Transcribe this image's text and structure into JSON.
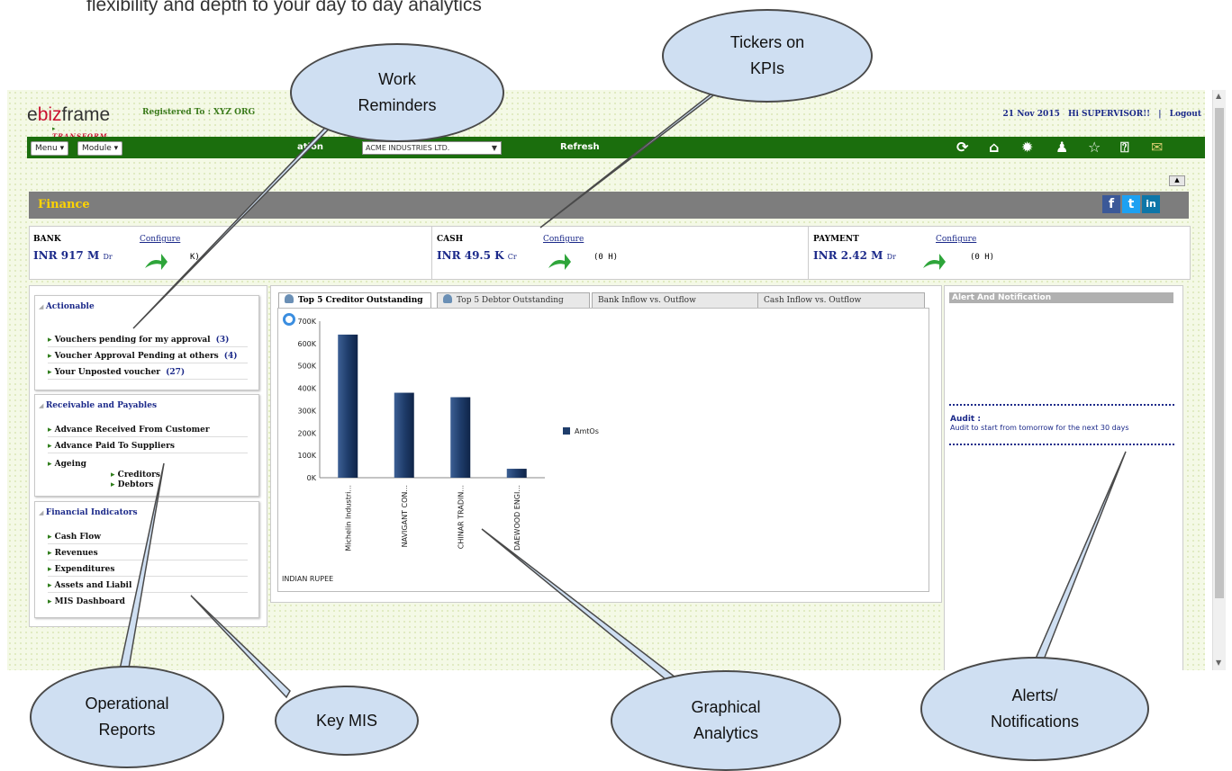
{
  "caption": "flexibility and depth to your day to day analytics",
  "header": {
    "logo_e": "e",
    "logo_biz": "biz",
    "logo_frame": "frame",
    "logo_sub": "TRANSFORM",
    "registered": "Registered To :  XYZ ORG",
    "date": "21 Nov 2015",
    "greeting": "Hi SUPERVISOR!!",
    "separator": "|",
    "logout": "Logout"
  },
  "toolbar": {
    "menu": "Menu ▾",
    "module": "Module ▾",
    "org_label": "ation",
    "org_value": "ACME INDUSTRIES LTD.",
    "refresh": "Refresh"
  },
  "finance": {
    "title": "Finance",
    "social": [
      "f",
      "t",
      "in"
    ]
  },
  "kpis": [
    {
      "name": "BANK",
      "configure": "Configure",
      "value": "INR  917  M",
      "unit": "Dr",
      "change": "K)"
    },
    {
      "name": "CASH",
      "configure": "Configure",
      "value": "INR  49.5  K",
      "unit": "Cr",
      "change": "(0 H)"
    },
    {
      "name": "PAYMENT",
      "configure": "Configure",
      "value": "INR  2.42  M",
      "unit": "Dr",
      "change": "(0 H)"
    }
  ],
  "actionable": {
    "title": "Actionable",
    "items": [
      {
        "label": "Vouchers pending for my approval",
        "count": "(3)"
      },
      {
        "label": "Voucher Approval Pending at others",
        "count": "(4)"
      },
      {
        "label": "Your Unposted voucher",
        "count": "(27)"
      }
    ]
  },
  "receivables": {
    "title": "Receivable and Payables",
    "items": [
      "Advance Received From Customer",
      "Advance Paid To Suppliers",
      "Ageing"
    ],
    "subitems": [
      "Creditors",
      "Debtors"
    ]
  },
  "indicators": {
    "title": "Financial Indicators",
    "items": [
      "Cash Flow",
      "Revenues",
      "Expenditures",
      "Assets and Liabil",
      "MIS Dashboard"
    ]
  },
  "tabs": [
    "Top 5 Creditor Outstanding",
    "Top 5 Debtor Outstanding",
    "Bank Inflow vs. Outflow",
    "Cash Inflow vs. Outflow"
  ],
  "chart_data": {
    "type": "bar",
    "categories": [
      "Michelin Industri...",
      "NAVIGANT CON...",
      "CHINAR TRADIN...",
      "DAEWOOD ENGI..."
    ],
    "values": [
      640000,
      380000,
      360000,
      40000
    ],
    "yticks": [
      "0K",
      "100K",
      "200K",
      "300K",
      "400K",
      "500K",
      "600K",
      "700K"
    ],
    "ylim": [
      0,
      700000
    ],
    "series": [
      {
        "name": "AmtOs",
        "color": "#1f3d6b"
      }
    ],
    "footer": "INDIAN RUPEE",
    "legend_position": "right"
  },
  "alerts": {
    "title": "Alert And Notification",
    "audit_title": "Audit :",
    "audit_text": "Audit to start from tomorrow for the next 30 days"
  },
  "callouts": {
    "work_reminders": [
      "Work",
      "Reminders"
    ],
    "tickers": [
      "Tickers on",
      "KPIs"
    ],
    "operational": [
      "Operational",
      "Reports"
    ],
    "key_mis": "Key MIS",
    "graphical": [
      "Graphical",
      "Analytics"
    ],
    "alerts": [
      "Alerts/",
      "Notifications"
    ]
  },
  "colors": {
    "toolbar_green": "#1b6e0d",
    "finance_header": "#7d7d7d",
    "bar_color": "#1f3d6b",
    "link_blue": "#1c2a8a",
    "bubble_fill": "#cfdff2"
  },
  "icons": [
    "refresh-icon",
    "home-icon",
    "settings-icon",
    "user-icon",
    "star-icon",
    "help-icon",
    "mail-icon"
  ]
}
